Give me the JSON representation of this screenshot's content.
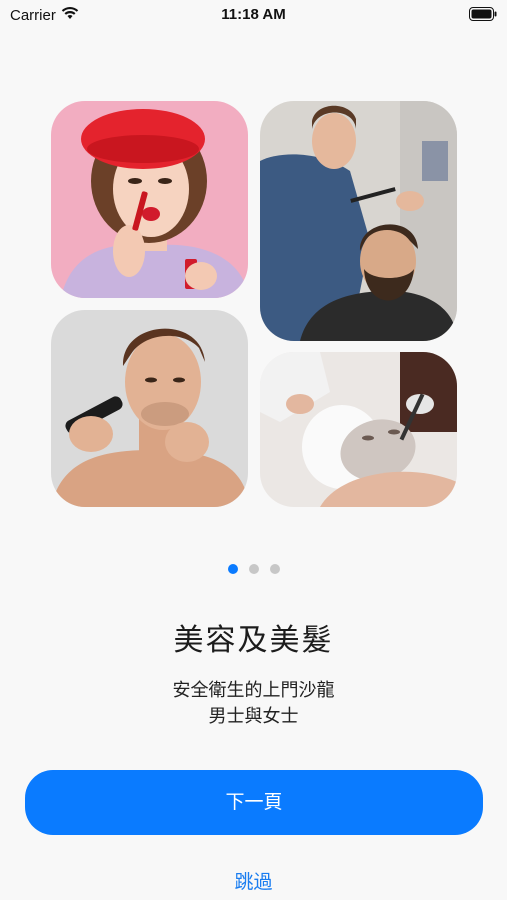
{
  "status_bar": {
    "carrier": "Carrier",
    "time": "11:18 AM"
  },
  "images": [
    {
      "label": "woman applying lipstick",
      "bg": "#f2a9bf"
    },
    {
      "label": "barber trimming beard",
      "bg": "#d9d6d1"
    },
    {
      "label": "man shaving with trimmer",
      "bg": "#dcdcdc"
    },
    {
      "label": "woman receiving facial mask",
      "bg": "#ece8e6"
    }
  ],
  "pager": {
    "count": 3,
    "active": 0
  },
  "onboarding": {
    "title": "美容及美髮",
    "subtitle_line1": "安全衛生的上門沙龍",
    "subtitle_line2": "男士與女士"
  },
  "buttons": {
    "next_label": "下一頁",
    "skip_label": "跳過"
  },
  "colors": {
    "accent": "#0a7bff",
    "dot_inactive": "#c7c7c7",
    "background": "#f8f8f8"
  }
}
